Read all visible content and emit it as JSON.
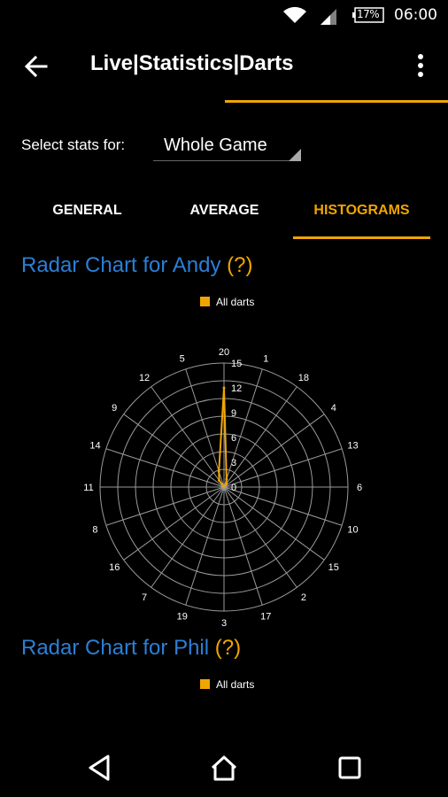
{
  "status": {
    "battery": "17%",
    "time": "06:00"
  },
  "appbar": {
    "title": "Live|Statistics|Darts"
  },
  "selector": {
    "label": "Select stats for:",
    "value": "Whole Game"
  },
  "tabs": [
    {
      "label": "GENERAL"
    },
    {
      "label": "AVERAGE"
    },
    {
      "label": "HISTOGRAMS",
      "active": true
    }
  ],
  "charts": [
    {
      "title": "Radar Chart for Andy",
      "help": "(?)",
      "legend": "All darts"
    },
    {
      "title": "Radar Chart for Phil",
      "help": "(?)",
      "legend": "All darts"
    }
  ],
  "colors": {
    "accent": "#f0a500",
    "title_blue": "#2b7fd6",
    "background": "#000000"
  },
  "chart_data": {
    "type": "radar",
    "title": "Radar Chart for Andy",
    "categories": [
      "20",
      "1",
      "18",
      "4",
      "13",
      "6",
      "10",
      "15",
      "2",
      "17",
      "3",
      "19",
      "7",
      "16",
      "8",
      "11",
      "14",
      "9",
      "12",
      "5"
    ],
    "radial_ticks": [
      0,
      3,
      6,
      9,
      12,
      15
    ],
    "rlim": [
      0,
      15
    ],
    "series": [
      {
        "name": "All darts",
        "values": [
          12,
          1,
          0.5,
          0,
          0,
          0,
          0,
          0,
          0,
          0,
          0,
          0,
          0,
          0,
          0,
          0,
          0,
          0,
          1,
          2
        ]
      }
    ]
  }
}
